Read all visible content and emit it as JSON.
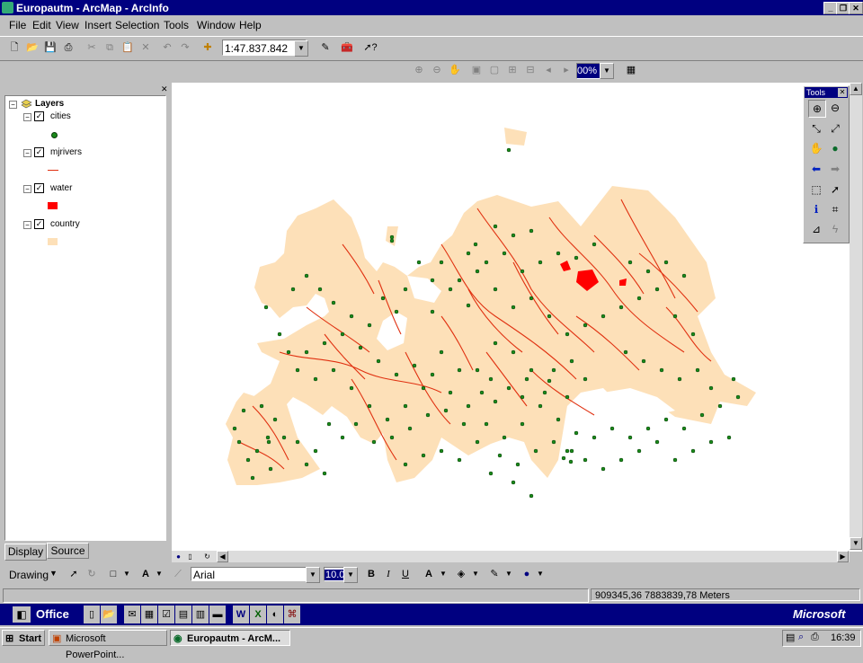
{
  "window": {
    "title": "Europautm - ArcMap - ArcInfo"
  },
  "menu": [
    "File",
    "Edit",
    "View",
    "Insert",
    "Selection",
    "Tools",
    "Window",
    "Help"
  ],
  "toolbar": {
    "scale_value": "1:47.837.842",
    "zoom_percent": "00%"
  },
  "toc": {
    "root_label": "Layers",
    "layers": [
      {
        "label": "cities",
        "checked": true,
        "symbol": "green-point"
      },
      {
        "label": "mjrivers",
        "checked": true,
        "symbol": "red-line"
      },
      {
        "label": "water",
        "checked": true,
        "symbol": "red-fill"
      },
      {
        "label": "country",
        "checked": true,
        "symbol": "tan-fill"
      }
    ],
    "tabs": {
      "display": "Display",
      "source": "Source"
    }
  },
  "tools_window": {
    "title": "Tools"
  },
  "drawing": {
    "label": "Drawing",
    "font": "Arial",
    "size": "10.0",
    "bold": "B",
    "italic": "I",
    "underline": "U"
  },
  "status": {
    "coords": "909345,36  7883839,78 Meters"
  },
  "office_bar": {
    "label": "Office",
    "brand": "Microsoft"
  },
  "taskbar": {
    "start": "Start",
    "tasks": [
      "Microsoft PowerPoint...",
      "Europautm - ArcM..."
    ],
    "clock": "16:39"
  },
  "colors": {
    "land": "#fde0b8",
    "rivers": "#e03010",
    "water": "#ff0000",
    "cities": "#1a8a1a",
    "title_bar": "#000080"
  }
}
